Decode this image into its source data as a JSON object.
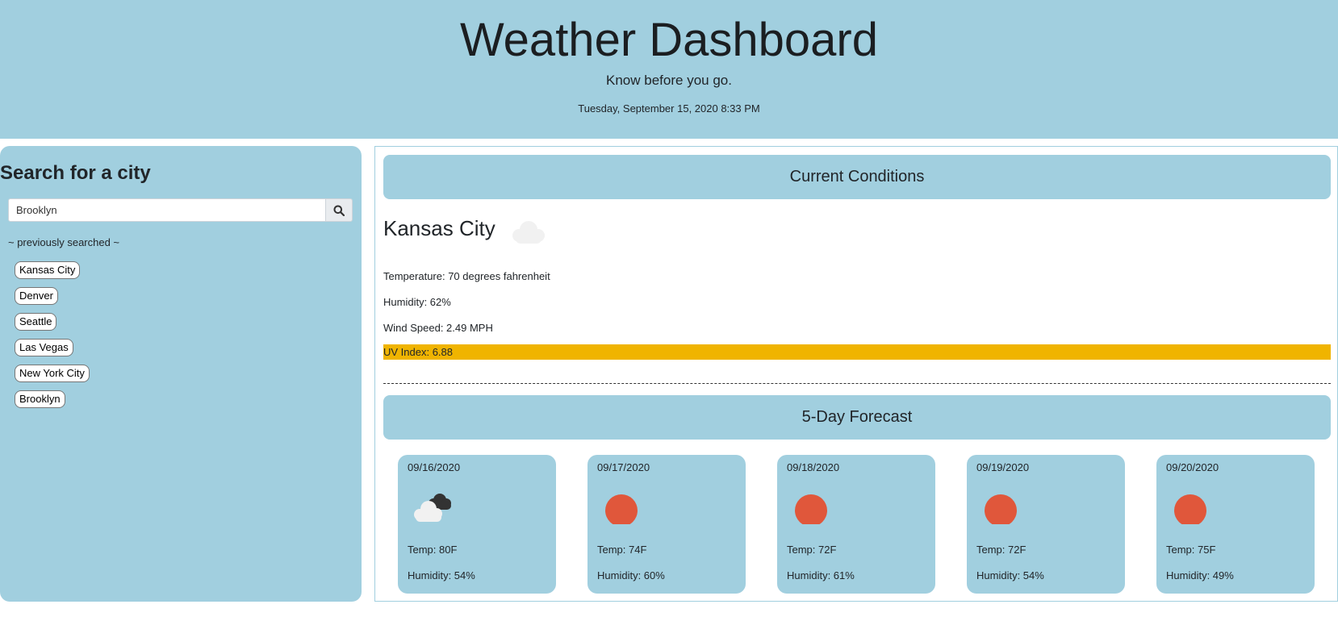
{
  "header": {
    "title": "Weather Dashboard",
    "tagline": "Know before you go.",
    "datetime": "Tuesday, September 15, 2020 8:33 PM"
  },
  "sidebar": {
    "heading": "Search for a city",
    "search": {
      "value": "Brooklyn",
      "icon": "search-icon"
    },
    "previous_label": "~ previously searched ~",
    "cities": [
      "Kansas City",
      "Denver",
      "Seattle",
      "Las Vegas",
      "New York City",
      "Brooklyn"
    ]
  },
  "current": {
    "banner": "Current Conditions",
    "city": "Kansas City",
    "icon": "cloud-icon",
    "temperature": "Temperature: 70 degrees fahrenheit",
    "humidity": "Humidity: 62%",
    "wind": "Wind Speed: 2.49 MPH",
    "uv": "UV Index: 6.88",
    "uv_color": "#f0b400"
  },
  "forecast": {
    "banner": "5-Day Forecast",
    "days": [
      {
        "date": "09/16/2020",
        "icon": "broken-clouds-icon",
        "temp": "Temp: 80F",
        "humidity": "Humidity: 54%"
      },
      {
        "date": "09/17/2020",
        "icon": "sun-icon",
        "temp": "Temp: 74F",
        "humidity": "Humidity: 60%"
      },
      {
        "date": "09/18/2020",
        "icon": "sun-icon",
        "temp": "Temp: 72F",
        "humidity": "Humidity: 61%"
      },
      {
        "date": "09/19/2020",
        "icon": "sun-icon",
        "temp": "Temp: 72F",
        "humidity": "Humidity: 54%"
      },
      {
        "date": "09/20/2020",
        "icon": "sun-icon",
        "temp": "Temp: 75F",
        "humidity": "Humidity: 49%"
      }
    ]
  },
  "colors": {
    "panel": "#a1cfdf",
    "sun": "#e0573b"
  }
}
